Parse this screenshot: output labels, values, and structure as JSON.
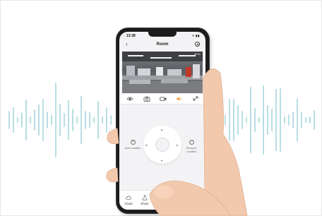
{
  "status_bar": {
    "time": "13:38",
    "icons": "▾ ▮▮"
  },
  "nav": {
    "back_glyph": "‹",
    "title": "Room"
  },
  "feed": {
    "timestamp": "09:41"
  },
  "ptz": {
    "up_glyph": "▴",
    "down_glyph": "▾",
    "left_glyph": "◂",
    "right_glyph": "▸",
    "add_location": "Add Location",
    "remove_location": "Remove Location",
    "add_glyph": "+",
    "remove_glyph": "−"
  },
  "bottom": {
    "cloud_label": "Cloud",
    "share_label": "Share"
  },
  "colors": {
    "accent": "#f29a3c",
    "wave": "#a8d6dd",
    "skin": "#f2c9ac"
  },
  "icons": [
    "eye-icon",
    "camera-icon",
    "video-icon",
    "speaker-icon",
    "fullscreen-icon",
    "settings-icon",
    "cloud-icon",
    "share-icon"
  ]
}
